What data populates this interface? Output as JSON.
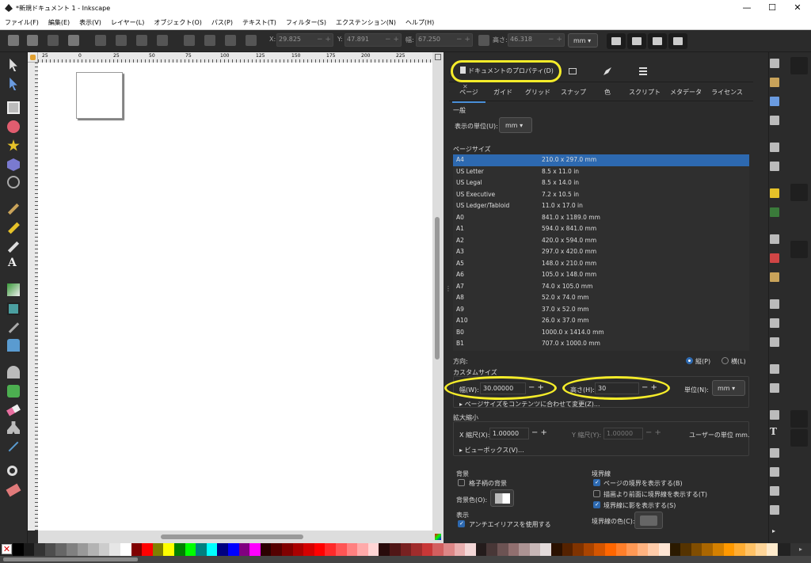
{
  "window": {
    "title": "*新規ドキュメント 1 - Inkscape",
    "minimize": "—",
    "maximize": "☐",
    "close": "✕"
  },
  "menu": [
    "ファイル(F)",
    "編集(E)",
    "表示(V)",
    "レイヤー(L)",
    "オブジェクト(O)",
    "パス(P)",
    "テキスト(T)",
    "フィルター(S)",
    "エクステンション(N)",
    "ヘルプ(H)"
  ],
  "toolbar": {
    "x_label": "X:",
    "x_value": "29.825",
    "y_label": "Y:",
    "y_value": "47.891",
    "w_label": "幅:",
    "w_value": "67.250",
    "h_label": "高さ:",
    "h_value": "46.318",
    "unit": "mm"
  },
  "ruler": {
    "top": [
      "25",
      "0",
      "25",
      "50",
      "75",
      "100",
      "125",
      "150",
      "175",
      "200",
      "225"
    ]
  },
  "dock": {
    "tab_label": "ドキュメントのプロパティ(D)",
    "tab_close": "✕"
  },
  "subtabs": [
    "ページ",
    "ガイド",
    "グリッド",
    "スナップ",
    "色",
    "スクリプト",
    "メタデータ",
    "ライセンス"
  ],
  "general": {
    "title": "一般",
    "unit_label": "表示の単位(U):",
    "unit_value": "mm"
  },
  "pagesize": {
    "title": "ページサイズ",
    "rows": [
      {
        "name": "A4",
        "size": "210.0 x 297.0 mm"
      },
      {
        "name": "US Letter",
        "size": "8.5 x 11.0 in"
      },
      {
        "name": "US Legal",
        "size": "8.5 x 14.0 in"
      },
      {
        "name": "US Executive",
        "size": "7.2 x 10.5 in"
      },
      {
        "name": "US Ledger/Tabloid",
        "size": "11.0 x 17.0 in"
      },
      {
        "name": "A0",
        "size": "841.0 x 1189.0 mm"
      },
      {
        "name": "A1",
        "size": "594.0 x 841.0 mm"
      },
      {
        "name": "A2",
        "size": "420.0 x 594.0 mm"
      },
      {
        "name": "A3",
        "size": "297.0 x 420.0 mm"
      },
      {
        "name": "A5",
        "size": "148.0 x 210.0 mm"
      },
      {
        "name": "A6",
        "size": "105.0 x 148.0 mm"
      },
      {
        "name": "A7",
        "size": "74.0 x 105.0 mm"
      },
      {
        "name": "A8",
        "size": "52.0 x 74.0 mm"
      },
      {
        "name": "A9",
        "size": "37.0 x 52.0 mm"
      },
      {
        "name": "A10",
        "size": "26.0 x 37.0 mm"
      },
      {
        "name": "B0",
        "size": "1000.0 x 1414.0 mm"
      },
      {
        "name": "B1",
        "size": "707.0 x 1000.0 mm"
      }
    ]
  },
  "orientation": {
    "label": "方向:",
    "portrait": "縦(P)",
    "landscape": "横(L)"
  },
  "custom": {
    "title": "カスタムサイズ",
    "width_label": "幅(W):",
    "width_value": "30.00000",
    "height_label": "高さ(H):",
    "height_value": "30",
    "unit_label": "単位(N):",
    "unit_value": "mm",
    "resize_label": "ページサイズをコンテンツに合わせて変更(Z)..."
  },
  "scale": {
    "title": "拡大縮小",
    "x_label": "X 縮尺(X):",
    "x_value": "1.00000",
    "y_label": "Y 縮尺(Y):",
    "y_value": "1.00000",
    "user_units": "ユーザーの単位 mm.",
    "viewbox": "ビューボックス(V)..."
  },
  "background": {
    "title": "背景",
    "checker": "格子柄の背景",
    "color_label": "背景色(O):"
  },
  "display": {
    "title": "表示",
    "antialias": "アンチエイリアスを使用する"
  },
  "border": {
    "title": "境界線",
    "show": "ページの境界を表示する(B)",
    "on_top": "描画より前面に境界線を表示する(T)",
    "shadow": "境界線に影を表示する(S)",
    "color_label": "境界線の色(C):"
  },
  "palette": [
    "#000000",
    "#1a1a1a",
    "#333333",
    "#4d4d4d",
    "#666666",
    "#808080",
    "#999999",
    "#b3b3b3",
    "#cccccc",
    "#e6e6e6",
    "#ffffff",
    "#800000",
    "#ff0000",
    "#808000",
    "#ffff00",
    "#008000",
    "#00ff00",
    "#008080",
    "#00ffff",
    "#000080",
    "#0000ff",
    "#800080",
    "#ff00ff",
    "#2b0000",
    "#550000",
    "#800000",
    "#aa0000",
    "#d40000",
    "#ff0000",
    "#ff2a2a",
    "#ff5555",
    "#ff8080",
    "#ffaaaa",
    "#ffd5d5",
    "#280b0b",
    "#501616",
    "#782121",
    "#a02c2c",
    "#c83737",
    "#d35f5f",
    "#de8787",
    "#e9afaf",
    "#f4d7d7",
    "#241c1c",
    "#483737",
    "#6c5353",
    "#916f6f",
    "#ac9393",
    "#c8b7b7",
    "#e3dbdb",
    "#2b1100",
    "#552200",
    "#803300",
    "#aa4400",
    "#d45500",
    "#ff6600",
    "#ff7f2a",
    "#ff9955",
    "#ffb380",
    "#ffccaa",
    "#ffe6d5",
    "#2b1a00",
    "#553300",
    "#804d00",
    "#aa6600",
    "#d48000",
    "#ff9900",
    "#ffad33",
    "#ffc266",
    "#ffd699",
    "#ffebcc"
  ]
}
